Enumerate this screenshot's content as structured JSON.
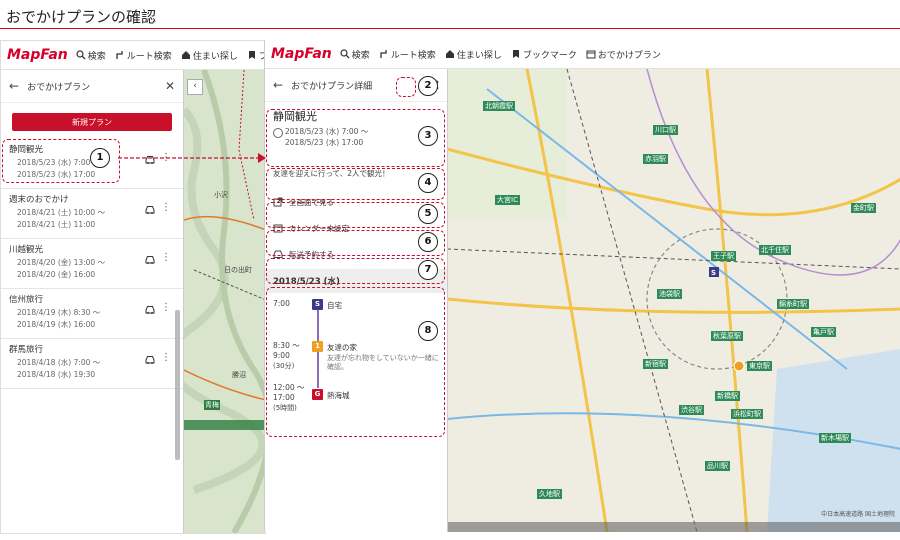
{
  "page": {
    "title": "おでかけプランの確認"
  },
  "nav": {
    "logo": "MapFan",
    "items": [
      "検索",
      "ルート検索",
      "住まい探し",
      "ブックマーク",
      "おでかけプラン"
    ]
  },
  "left_panel": {
    "header": "おでかけプラン",
    "new_button": "新規プラン",
    "plans": [
      {
        "name": "静岡観光",
        "start": "2018/5/23 (水) 7:00 ～",
        "end": "2018/5/23 (水) 17:00"
      },
      {
        "name": "週末のおでかけ",
        "start": "2018/4/21 (土) 10:00 ～",
        "end": "2018/4/21 (土) 11:00"
      },
      {
        "name": "川越観光",
        "start": "2018/4/20 (金) 13:00 ～",
        "end": "2018/4/20 (金) 16:00"
      },
      {
        "name": "信州旅行",
        "start": "2018/4/19 (木) 8:30 ～",
        "end": "2018/4/19 (木) 16:00"
      },
      {
        "name": "群馬旅行",
        "start": "2018/4/18 (水) 7:00 ～",
        "end": "2018/4/18 (水) 19:30"
      }
    ]
  },
  "detail_panel": {
    "header": "おでかけプラン詳細",
    "title": "静岡観光",
    "start": "2018/5/23 (水) 7:00 ～",
    "end": "2018/5/23 (水) 17:00",
    "memo": "友達を迎えに行って、2人で観光！",
    "full_map": "全画面で見る",
    "calendar": "カレンダー未設定",
    "transfer": "転送予約する",
    "day": "2018/5/23 (水)",
    "schedule": [
      {
        "time": "7:00",
        "marker": "S",
        "place": "自宅",
        "note": ""
      },
      {
        "time": "8:30 ～",
        "time2": "9:00",
        "duration": "(30分)",
        "marker": "1",
        "place": "友達の家",
        "note": "友達が忘れ物をしていないか一緒に確認。"
      },
      {
        "time": "12:00 ～",
        "time2": "17:00",
        "duration": "(5時間)",
        "marker": "G",
        "place": "熱海城",
        "note": ""
      }
    ]
  },
  "callouts": [
    "1",
    "2",
    "3",
    "4",
    "5",
    "6",
    "7",
    "8"
  ],
  "map_labels": {
    "terrain": [
      "小沢",
      "日の出町",
      "青梅",
      "勝沼"
    ],
    "city": [
      "北朝霞駅",
      "赤羽駅",
      "川口駅",
      "大宮IC",
      "王子駅",
      "池袋駅",
      "新宿駅",
      "秋葉原駅",
      "東京駅",
      "新橋駅",
      "浜松町駅",
      "渋谷駅",
      "品川駅",
      "北千住駅",
      "亀戸駅",
      "錦糸町駅",
      "金町駅",
      "新木場駅",
      "久地駅"
    ]
  },
  "map_credit": "中日本高速道路 国土地理院",
  "colors": {
    "brand": "#d6002a",
    "button": "#c9102a",
    "callout": "#c8102e",
    "start_marker": "#3a3a8c",
    "via_marker": "#f0a020",
    "goal_marker": "#c8102e"
  }
}
